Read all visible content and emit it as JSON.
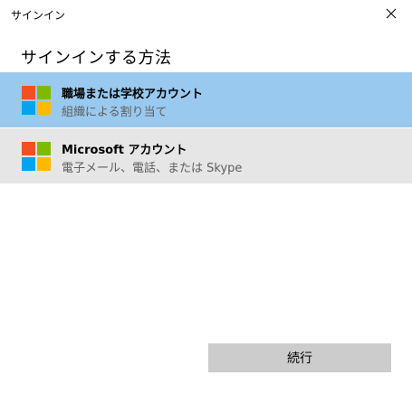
{
  "window": {
    "title": "サインイン",
    "close_icon": "close-icon"
  },
  "heading": "サインインする方法",
  "options": [
    {
      "title": "職場または学校アカウント",
      "subtitle": "組織による割り当て",
      "icon": "microsoft-logo-icon",
      "selected": true
    },
    {
      "title": "Microsoft アカウント",
      "subtitle": "電子メール、電話、または Skype",
      "icon": "microsoft-logo-icon",
      "selected": false
    }
  ],
  "continue_label": "続行",
  "colors": {
    "selected_bg": "#99c9ef",
    "option_bg": "#e6e6e6",
    "button_bg": "#cccccc",
    "logo_red": "#f25022",
    "logo_green": "#7fba00",
    "logo_blue": "#00a4ef",
    "logo_yellow": "#ffb900"
  }
}
